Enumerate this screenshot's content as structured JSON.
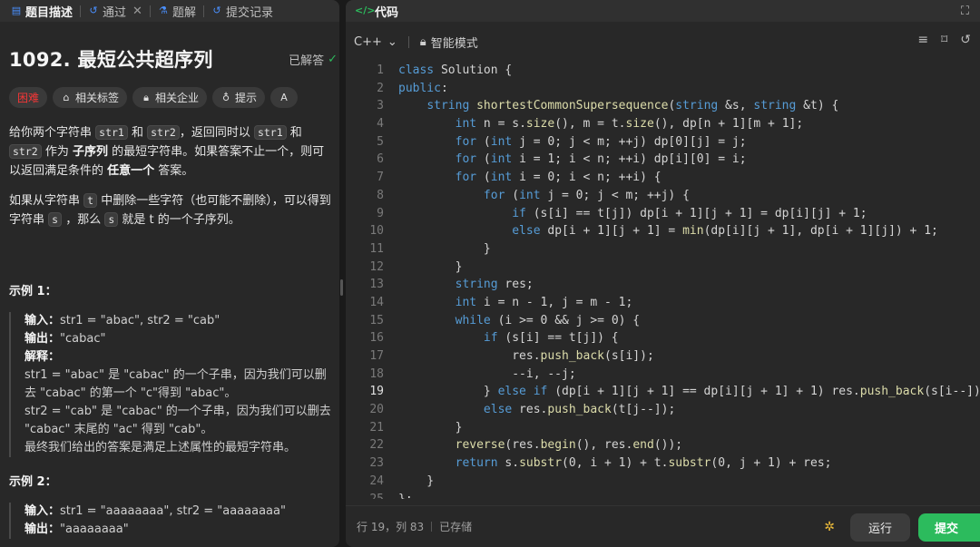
{
  "left_tabs": [
    {
      "label": "题目描述",
      "icon": "document-icon",
      "active": true
    },
    {
      "label": "通过",
      "icon": "history-icon",
      "closable": true
    },
    {
      "label": "题解",
      "icon": "flask-icon"
    },
    {
      "label": "提交记录",
      "icon": "history-icon"
    }
  ],
  "problem": {
    "title": "1092. 最短公共超序列",
    "status": "已解答",
    "tags": [
      {
        "label": "困难",
        "icon": ""
      },
      {
        "label": "相关标签",
        "icon": "tag-icon"
      },
      {
        "label": "相关企业",
        "icon": "lock-icon"
      },
      {
        "label": "提示",
        "icon": "bulb-icon"
      },
      {
        "label": "",
        "icon": "translate-icon"
      }
    ],
    "desc1": {
      "t1": "给你两个字符串 ",
      "c1": "str1",
      "t2": " 和 ",
      "c2": "str2",
      "t3": "，返回同时以 ",
      "c3": "str1",
      "t4": " 和 ",
      "c4": "str2",
      "t5": " 作为 ",
      "b1": "子序列",
      "t6": " 的最短字符串。如果答案不止一个，则可以返回满足条件的 ",
      "b2": "任意一个",
      "t7": " 答案。"
    },
    "desc2": {
      "t1": "如果从字符串 ",
      "c1": "t",
      "t2": " 中删除一些字符（也可能不删除），可以得到字符串 ",
      "c2": "s",
      "t3": " ，那么 ",
      "c3": "s",
      "t4": " 就是 t 的一个子序列。"
    },
    "example1": {
      "title": "示例 1：",
      "input_label": "输入：",
      "input": "str1 = \"abac\", str2 = \"cab\"",
      "output_label": "输出：",
      "output": "\"cabac\"",
      "explain_label": "解释：",
      "explain": [
        "str1 = \"abac\" 是 \"cabac\" 的一个子串，因为我们可以删去 \"cabac\" 的第一个 \"c\"得到 \"abac\"。",
        "str2 = \"cab\" 是 \"cabac\" 的一个子串，因为我们可以删去 \"cabac\" 末尾的 \"ac\" 得到 \"cab\"。",
        "最终我们给出的答案是满足上述属性的最短字符串。"
      ]
    },
    "example2": {
      "title": "示例 2：",
      "input_label": "输入：",
      "input": "str1 = \"aaaaaaaa\", str2 = \"aaaaaaaa\"",
      "output_label": "输出：",
      "output": "\"aaaaaaaa\""
    }
  },
  "editor": {
    "header_title": "代码",
    "language": "C++",
    "mode": "智能模式",
    "current_line": 19,
    "lines": [
      "class Solution {",
      "public:",
      "    string shortestCommonSupersequence(string &s, string &t) {",
      "        int n = s.size(), m = t.size(), dp[n + 1][m + 1];",
      "        for (int j = 0; j < m; ++j) dp[0][j] = j;",
      "        for (int i = 1; i < n; ++i) dp[i][0] = i;",
      "        for (int i = 0; i < n; ++i) {",
      "            for (int j = 0; j < m; ++j) {",
      "                if (s[i] == t[j]) dp[i + 1][j + 1] = dp[i][j] + 1;",
      "                else dp[i + 1][j + 1] = min(dp[i][j + 1], dp[i + 1][j]) + 1;",
      "            }",
      "        }",
      "        string res;",
      "        int i = n - 1, j = m - 1;",
      "        while (i >= 0 && j >= 0) {",
      "            if (s[i] == t[j]) {",
      "                res.push_back(s[i]);",
      "                --i, --j;",
      "            } else if (dp[i + 1][j + 1] == dp[i][j + 1] + 1) res.push_back(s[i--]);",
      "            else res.push_back(t[j--]);",
      "        }",
      "        reverse(res.begin(), res.end());",
      "        return s.substr(0, i + 1) + t.substr(0, j + 1) + res;",
      "    }",
      "};"
    ],
    "status_position": "行 19，列 83",
    "status_saved": "已存储",
    "run_label": "运行",
    "submit_label": "提交"
  },
  "colors": {
    "keyword": "#569cd6",
    "function": "#dcdcaa",
    "accent_green": "#2cbb5d",
    "hard": "#f63636"
  }
}
